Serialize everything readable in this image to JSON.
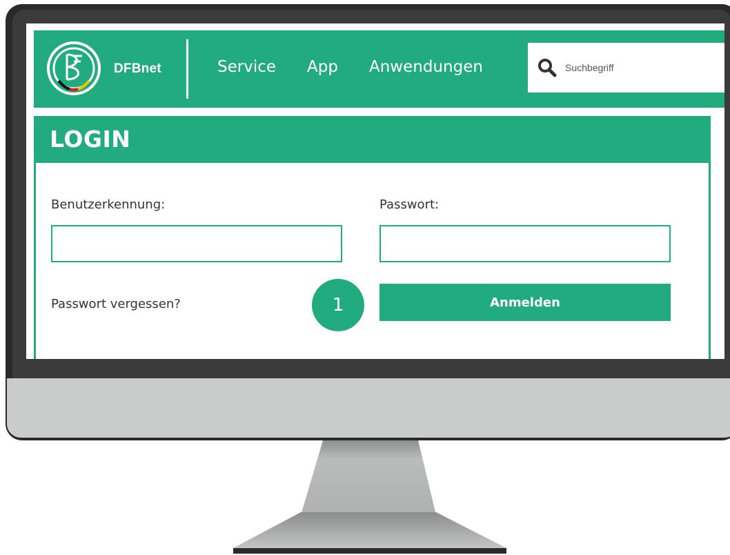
{
  "header": {
    "brand": "DFBnet",
    "nav": [
      {
        "label": "Service"
      },
      {
        "label": "App"
      },
      {
        "label": "Anwendungen"
      }
    ],
    "search": {
      "placeholder": "Suchbegriff",
      "icon": "search-icon"
    }
  },
  "login": {
    "title": "LOGIN",
    "username_label": "Benutzerkennung:",
    "username_value": "",
    "password_label": "Passwort:",
    "password_value": "",
    "forgot_label": "Passwort vergessen?",
    "submit_label": "Anmelden"
  },
  "annotation": {
    "step": "1"
  },
  "colors": {
    "accent": "#22ab7f",
    "monitor_frame": "#2a2a2a",
    "monitor_chin": "#c9ccca",
    "stand": "#a9acaa"
  }
}
